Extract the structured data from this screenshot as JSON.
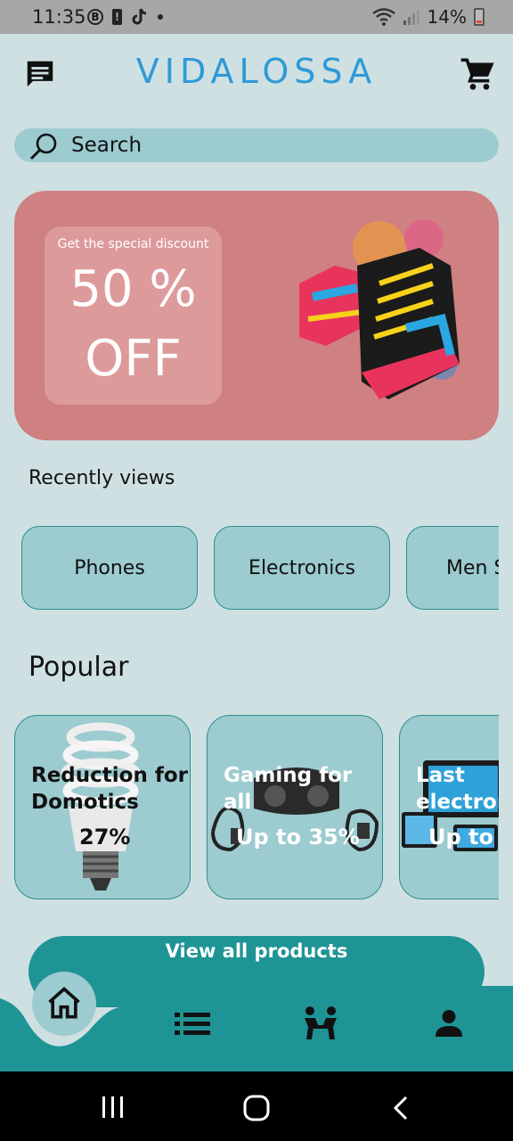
{
  "status_bar": {
    "time": "11:35",
    "battery": "14%"
  },
  "header": {
    "logo": "VIDALOSSA",
    "chat_icon": "chat-icon",
    "cart_icon": "cart-icon"
  },
  "search": {
    "placeholder": "Search"
  },
  "banner": {
    "subtitle": "Get the special discount",
    "line1": "50 %",
    "line2": "OFF"
  },
  "recent": {
    "title": "Recently views",
    "chips": [
      "Phones",
      "Electronics",
      "Men S"
    ]
  },
  "popular": {
    "title": "Popular",
    "cards": [
      {
        "title1": "Reduction for",
        "title2": "Domotics",
        "promo": "27%"
      },
      {
        "title1": "Gaming for",
        "title2": "all",
        "promo": "Up to 35%"
      },
      {
        "title1": "Last",
        "title2": "electron",
        "promo": "Up to"
      }
    ]
  },
  "actions": {
    "view_all": "View all products"
  },
  "bottom_nav": {
    "items": [
      "home-icon",
      "list-icon",
      "community-icon",
      "profile-icon"
    ]
  },
  "colors": {
    "background": "#cfe0e3",
    "accent": "#1f9495",
    "banner": "#cf8080",
    "logo": "#2e9ad6"
  }
}
